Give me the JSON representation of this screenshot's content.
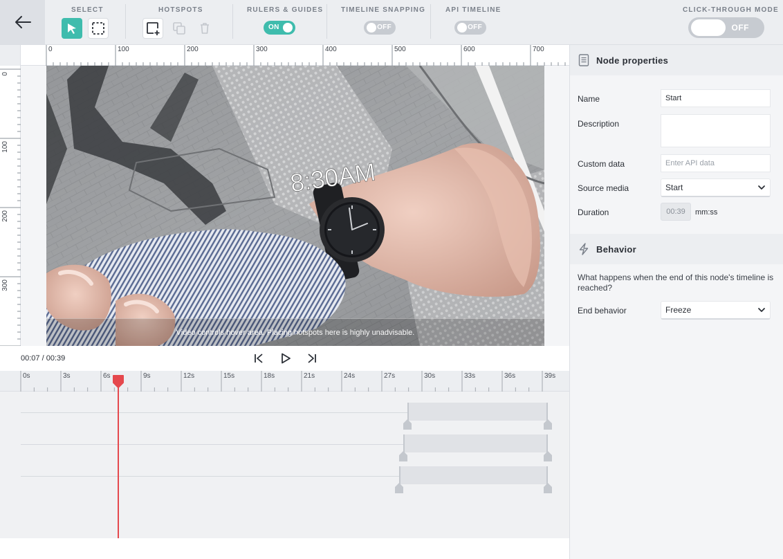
{
  "toolbar": {
    "select_label": "SELECT",
    "hotspots_label": "HOTSPOTS",
    "rulers_label": "RULERS & GUIDES",
    "rulers_toggle": "ON",
    "snapping_label": "TIMELINE SNAPPING",
    "snapping_toggle": "OFF",
    "api_label": "API TIMELINE",
    "api_toggle": "OFF",
    "clickthrough_label": "CLICK-THROUGH MODE",
    "clickthrough_toggle": "OFF"
  },
  "rulers": {
    "horizontal": [
      "0",
      "100",
      "200",
      "300",
      "400",
      "500",
      "600",
      "700"
    ],
    "vertical": [
      "0",
      "100",
      "200",
      "300"
    ]
  },
  "video": {
    "hover_notice": "Video controls hover area. Placing hotspots here is highly unadvisable.",
    "overlay_text": "8:30AM"
  },
  "playback": {
    "current_time": "00:07",
    "total_time": "00:39",
    "separator": " / "
  },
  "timeline": {
    "ticks": [
      "0s",
      "3s",
      "6s",
      "9s",
      "12s",
      "15s",
      "18s",
      "21s",
      "24s",
      "27s",
      "30s",
      "33s",
      "36s",
      "39s"
    ],
    "playhead_seconds": 7.3,
    "duration_seconds": 39,
    "tracks": [
      {
        "start": 28.9,
        "end": 39
      },
      {
        "start": 28.6,
        "end": 39
      },
      {
        "start": 28.3,
        "end": 39
      }
    ]
  },
  "panel": {
    "node_title": "Node properties",
    "name_label": "Name",
    "name_value": "Start",
    "description_label": "Description",
    "description_value": "",
    "custom_label": "Custom data",
    "custom_placeholder": "Enter API data",
    "source_label": "Source media",
    "source_value": "Start",
    "duration_label": "Duration",
    "duration_value": "00:39",
    "duration_unit": "mm:ss",
    "behavior_title": "Behavior",
    "behavior_help": "What happens when the end of this node's timeline is reached?",
    "end_label": "End behavior",
    "end_value": "Freeze"
  },
  "colors": {
    "accent": "#3fbcad",
    "playhead": "#e5484d"
  }
}
